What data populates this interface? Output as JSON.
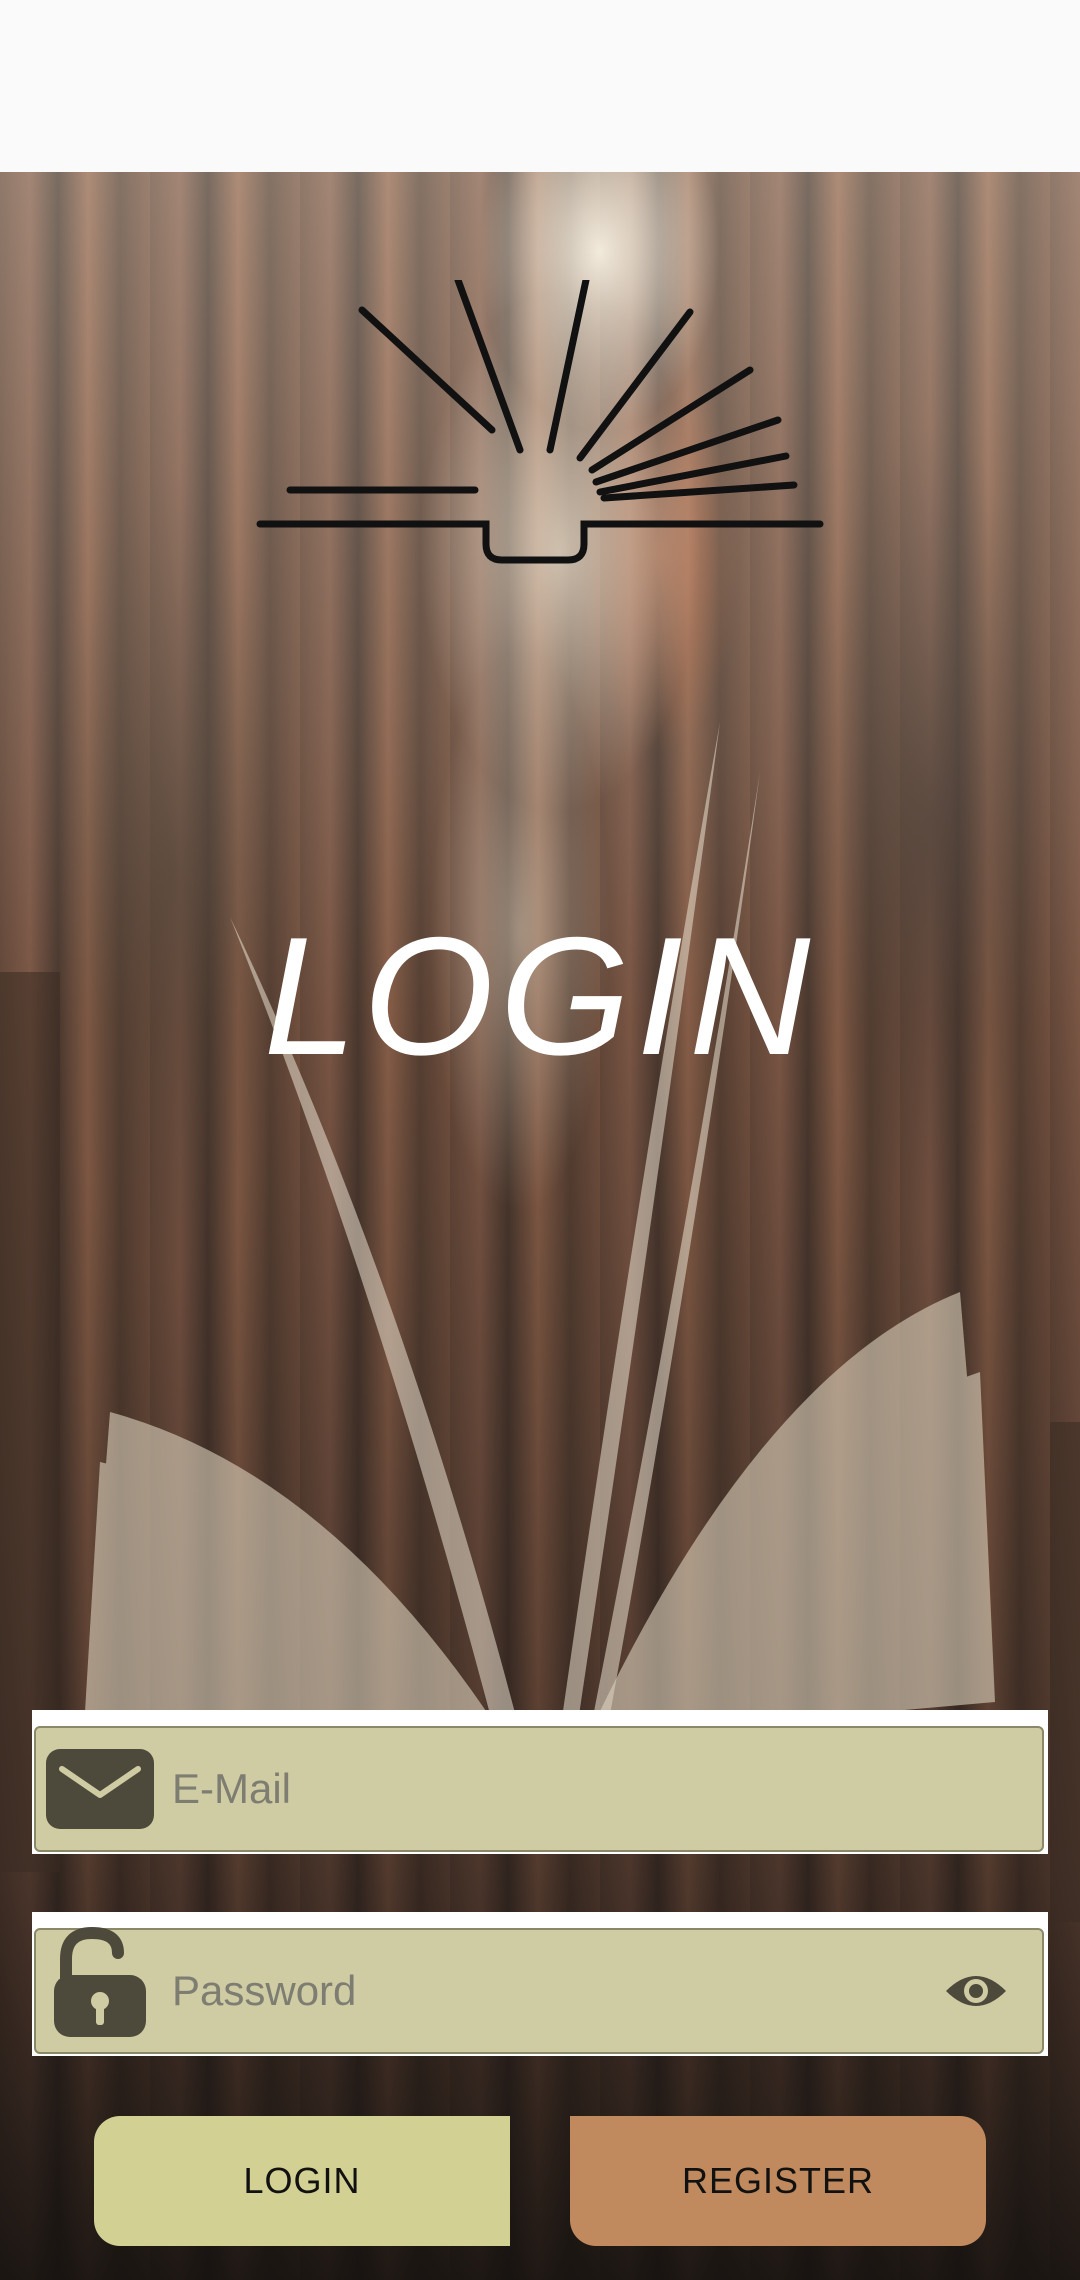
{
  "title": "LOGIN",
  "email": {
    "placeholder": "E-Mail",
    "icon": "envelope-icon"
  },
  "password": {
    "placeholder": "Password",
    "icon": "unlock-icon",
    "toggle_icon": "eye-icon"
  },
  "buttons": {
    "login_label": "LOGIN",
    "register_label": "REGISTER"
  },
  "colors": {
    "field_bg": "#cfcca4",
    "login_button": "#d3d093",
    "register_button": "#c08a5e",
    "icon_dark": "#4d4a3c"
  }
}
